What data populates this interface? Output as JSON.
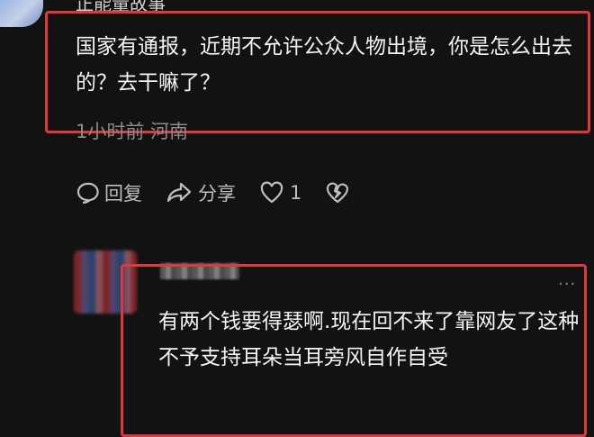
{
  "top_comment": {
    "username": "正能量故事",
    "text": "国家有通报，近期不允许公众人物出境，你是怎么出去的？去干嘛了？",
    "meta": "1小时前 河南",
    "actions": {
      "reply": "回复",
      "share": "分享",
      "like_count": "1"
    }
  },
  "reply": {
    "text": "有两个钱要得瑟啊.现在回不来了靠网友了这种不予支持耳朵当耳旁风自作自受",
    "more": "···"
  },
  "colors": {
    "highlight": "#e2363d",
    "background": "#121212"
  }
}
